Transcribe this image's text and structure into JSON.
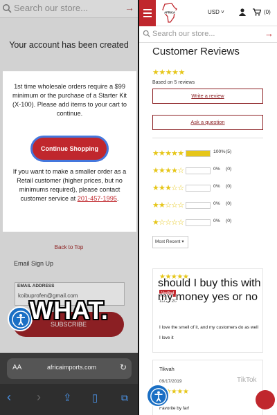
{
  "left": {
    "search": {
      "placeholder": "Search our store..."
    },
    "account_created": "Your account has been created",
    "modal": {
      "message1": "1st time wholesale orders require a $99 minimum or the purchase of a Starter Kit (X-100). Please add items to your cart to continue.",
      "button_label": "Continue Shopping",
      "message2": "If you want to make a smaller order as a Retail customer (higher prices, but no minimums required), please contact customer service at ",
      "phone": "201-457-1995",
      "message2_end": "."
    },
    "back_to_top": "Back to Top",
    "email_signup_title": "Email Sign Up",
    "email_label": "EMAIL ADDRESS",
    "email_value": "koibuprofen@gmail.com",
    "subscribe_label": "SUBSCRIBE",
    "caption": "WHAT.",
    "browser": {
      "aa_label": "AA",
      "url": "africaimports.com",
      "toolbar": [
        "back-icon",
        "forward-icon",
        "share-icon",
        "bookmarks-icon",
        "tabs-icon"
      ]
    }
  },
  "right": {
    "currency": "USD",
    "cart_count": "(0)",
    "search": {
      "placeholder": "Search our store..."
    },
    "reviews_title": "Customer Reviews",
    "based_on": "Based on 5 reviews",
    "write_review": "Write a review",
    "ask_question": "Ask a question",
    "histogram": [
      {
        "stars": 5,
        "percent": "100%",
        "count": "(5)",
        "fill": 1.0
      },
      {
        "stars": 4,
        "percent": "0%",
        "count": "(0)",
        "fill": 0
      },
      {
        "stars": 3,
        "percent": "0%",
        "count": "(0)",
        "fill": 0
      },
      {
        "stars": 2,
        "percent": "0%",
        "count": "(0)",
        "fill": 0
      },
      {
        "stars": 1,
        "percent": "0%",
        "count": "(0)",
        "fill": 0
      }
    ],
    "sort_label": "Most Recent",
    "overlay_caption": "should I buy this with my money yes or no",
    "review1": {
      "verified": "Verified",
      "date": "11/12/20",
      "body": "I love the smell of it, and my customers do as well",
      "body2": "I love it"
    },
    "review2": {
      "name": "Tikvah",
      "date": "09/17/2019",
      "body": "Favorite by far!"
    },
    "watermark": "TikTok"
  },
  "colors": {
    "brand_red": "#c0272d",
    "star_yellow": "#e6c619",
    "access_blue": "#1a6fc4"
  }
}
